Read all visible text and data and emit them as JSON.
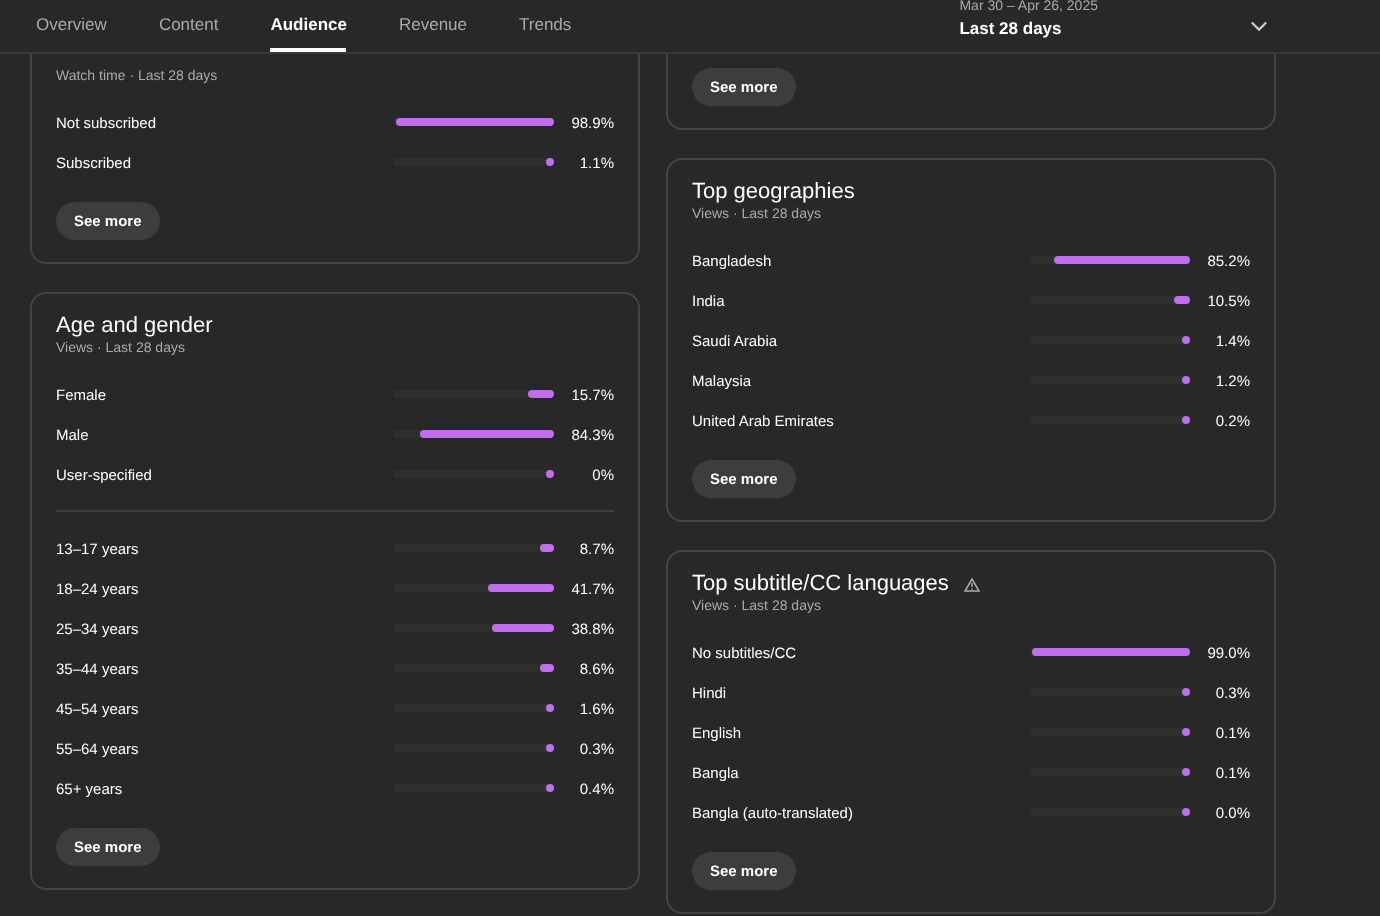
{
  "tabs": [
    {
      "label": "Overview",
      "selected": false
    },
    {
      "label": "Content",
      "selected": false
    },
    {
      "label": "Audience",
      "selected": true
    },
    {
      "label": "Revenue",
      "selected": false
    },
    {
      "label": "Trends",
      "selected": false
    }
  ],
  "date_range": {
    "range": "Mar 30 – Apr 26, 2025",
    "label": "Last 28 days"
  },
  "left_column": [
    {
      "subtitle": "Watch time · Last 28 days",
      "groups": [
        [
          {
            "label": "Not subscribed",
            "level": 0.989,
            "value": "98.9%"
          },
          {
            "label": "Subscribed",
            "level": 0.011,
            "value": "1.1%"
          }
        ]
      ],
      "button": "See more"
    },
    {
      "title": "Age and gender",
      "subtitle": "Views · Last 28 days",
      "groups": [
        [
          {
            "label": "Female",
            "level": 0.157,
            "value": "15.7%"
          },
          {
            "label": "Male",
            "level": 0.843,
            "value": "84.3%"
          },
          {
            "label": "User-specified",
            "level": 0,
            "value": "0%"
          }
        ],
        [
          {
            "label": "13–17 years",
            "level": 0.087,
            "value": "8.7%"
          },
          {
            "label": "18–24 years",
            "level": 0.417,
            "value": "41.7%"
          },
          {
            "label": "25–34 years",
            "level": 0.388,
            "value": "38.8%"
          },
          {
            "label": "35–44 years",
            "level": 0.086,
            "value": "8.6%"
          },
          {
            "label": "45–54 years",
            "level": 0.016,
            "value": "1.6%"
          },
          {
            "label": "55–64 years",
            "level": 0.003,
            "value": "0.3%"
          },
          {
            "label": "65+ years",
            "level": 0.004,
            "value": "0.4%"
          }
        ]
      ],
      "button": "See more"
    }
  ],
  "right_column": [
    {
      "button": "See more"
    },
    {
      "title": "Top geographies",
      "subtitle": "Views · Last 28 days",
      "groups": [
        [
          {
            "label": "Bangladesh",
            "level": 0.852,
            "value": "85.2%"
          },
          {
            "label": "India",
            "level": 0.105,
            "value": "10.5%"
          },
          {
            "label": "Saudi Arabia",
            "level": 0.014,
            "value": "1.4%"
          },
          {
            "label": "Malaysia",
            "level": 0.012,
            "value": "1.2%"
          },
          {
            "label": "United Arab Emirates",
            "level": 0.002,
            "value": "0.2%"
          }
        ]
      ],
      "button": "See more"
    },
    {
      "title": "Top subtitle/CC languages",
      "warning": true,
      "subtitle": "Views · Last 28 days",
      "groups": [
        [
          {
            "label": "No subtitles/CC",
            "level": 0.99,
            "value": "99.0%"
          },
          {
            "label": "Hindi",
            "level": 0.003,
            "value": "0.3%"
          },
          {
            "label": "English",
            "level": 0.001,
            "value": "0.1%"
          },
          {
            "label": "Bangla",
            "level": 0.001,
            "value": "0.1%"
          },
          {
            "label": "Bangla (auto-translated)",
            "level": 0,
            "value": "0.0%"
          }
        ]
      ],
      "button": "See more"
    }
  ]
}
